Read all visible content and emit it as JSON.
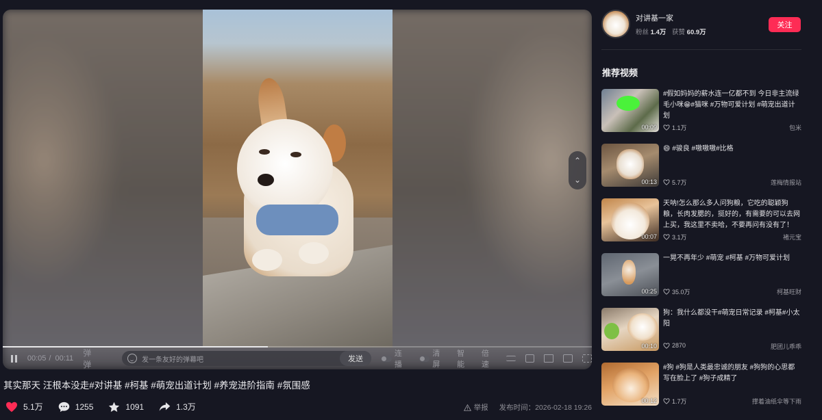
{
  "player": {
    "time_current": "00:05",
    "time_separator": "/",
    "time_total": "00:11",
    "progress_fraction": 0.45,
    "danmu_icons": "弹 弹",
    "danmu_placeholder": "发一条友好的弹幕吧",
    "send_label": "发送",
    "toggle_lianbo": "连播",
    "toggle_qingping": "清屏",
    "smart_label": "智能",
    "speed_label": "倍速",
    "nav_up": "⌃",
    "nav_down": "⌄"
  },
  "caption": "其实那天 汪根本没走#对讲基 #柯基 #萌宠出道计划 #养宠进阶指南 #氛围感",
  "stats": {
    "likes": "5.1万",
    "comments": "1255",
    "favorites": "1091",
    "shares": "1.3万"
  },
  "meta": {
    "report": "举报",
    "publish_time": "发布时间：2026-02-18 19:26"
  },
  "author": {
    "name": "对讲基一家",
    "fans_label": "粉丝",
    "fans": "1.4万",
    "likes_label": "获赞",
    "likes": "60.9万",
    "follow_label": "关注"
  },
  "recommend": {
    "title": "推荐视频",
    "items": [
      {
        "text": "#假如妈妈的薪水连一亿都不到 今日非主流绿毛小咪😁#猫咪 #万物可爱计划 #萌宠出道计划",
        "duration": "00:09",
        "likes": "1.1万",
        "author": "包米"
      },
      {
        "text": "😄 #骏良 #嗷嗷嗷#比格",
        "duration": "00:13",
        "likes": "5.7万",
        "author": "莲梅情报站"
      },
      {
        "text": "天呐!怎么那么多人问狗粮，它吃的聪颖狗粮，长肉发腮的，挺好的，有需要的可以去网上买，我这里不卖哈，不要再问有没有了！#...",
        "duration": "00:07",
        "likes": "3.1万",
        "author": "褚元宝"
      },
      {
        "text": "一晃不再年少 #萌宠 #柯基 #万物可爱计划",
        "duration": "00:25",
        "likes": "35.0万",
        "author": "柯基旺财"
      },
      {
        "text": "狗：我什么都没干#萌宠日常记录 #柯基#小太阳",
        "duration": "00:10",
        "likes": "2870",
        "author": "肥团儿乖乖"
      },
      {
        "text": "#狗 #狗是人类最忠诚的朋友 #狗狗的心思都写在脸上了 #狗子成精了",
        "duration": "00:12",
        "likes": "1.7万",
        "author": "撑着油纸伞等下雨"
      }
    ]
  },
  "colors": {
    "accent": "#fe2c55",
    "background": "#161722",
    "like_red": "#fe2c55"
  }
}
